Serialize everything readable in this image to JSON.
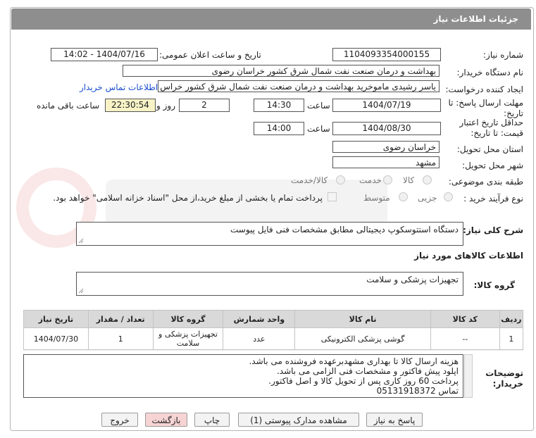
{
  "header": {
    "title": "جزئیات اطلاعات نیاز"
  },
  "fields": {
    "need_number_label": "شماره نیاز:",
    "need_number": "1104093354000155",
    "announce_label": "تاریخ و ساعت اعلان عمومی:",
    "announce_value": "1404/07/16 - 14:02",
    "buyer_label": "نام دستگاه خریدار:",
    "buyer_value": "بهداشت و درمان صنعت نفت شمال شرق کشور   خراسان رضوی",
    "requester_label": "ایجاد کننده درخواست:",
    "requester_value": "یاسر رشیدی ماموخرید بهداشت و درمان صنعت نفت شمال شرق کشور   خراس",
    "contact_link": "اطلاعات تماس خریدار",
    "deadline_label_1": "مهلت ارسال پاسخ: تا",
    "deadline_label_2": "تاریخ:",
    "deadline_date": "1404/07/19",
    "time_label": "ساعت",
    "deadline_time": "14:30",
    "days_value": "2",
    "days_label": "روز و",
    "remaining_value": "22:30:54",
    "remaining_label": "ساعت باقی مانده",
    "validity_label_1": "حداقل تاریخ اعتبار",
    "validity_label_2": "قیمت: تا تاریخ:",
    "validity_date": "1404/08/30",
    "validity_time": "14:00",
    "province_label": "استان محل تحویل:",
    "province_value": "خراسان رضوی",
    "city_label": "شهر محل تحویل:",
    "city_value": "مشهد",
    "category_label": "طبقه بندی موضوعی:",
    "category_options": [
      "کالا",
      "خدمت",
      "کالا/خدمت"
    ],
    "purchase_label": "نوع فرآیند خرید :",
    "purchase_options": [
      "جزیی",
      "متوسط"
    ],
    "payment_note": "پرداخت تمام یا بخشی از مبلغ خرید،از محل \"اسناد خزانه اسلامی\" خواهد بود."
  },
  "description": {
    "label": "شرح کلی نیاز:",
    "value": "دستگاه استتوسکوپ دیجیتالی مطابق مشخصات فنی فایل پیوست"
  },
  "goods_info_label": "اطلاعات کالاهای مورد نیاز",
  "goods_group": {
    "label": "گروه کالا:",
    "value": "تجهیزات پزشکی و سلامت"
  },
  "table": {
    "headers": [
      "ردیف",
      "کد کالا",
      "نام کالا",
      "واحد شمارش",
      "گروه کالا",
      "تعداد / مقدار",
      "تاریخ نیاز"
    ],
    "rows": [
      [
        "1",
        "--",
        "گوشی پزشکی الکترونیکی",
        "عدد",
        "تجهیزات پزشکی و سلامت",
        "1",
        "1404/07/30"
      ]
    ]
  },
  "buyer_notes": {
    "label_1": "توضیحات",
    "label_2": "خریدار:",
    "lines": [
      "هزینه ارسال کالا تا بهداری مشهدبرعهده فروشنده می باشد.",
      "اپلود پیش فاکتور و مشخصات فنی الزامی می باشد.",
      "پرداخت 60 روز کاری پس از تحویل کالا و اصل فاکتور.",
      "تماس 05131918372"
    ]
  },
  "buttons": {
    "respond": "پاسخ به نیاز",
    "attachments": "مشاهده مدارک پیوستی (1)",
    "print": "چاپ",
    "back": "بازگشت",
    "exit": "خروج"
  },
  "colors": {
    "header_bg": "#8e8e8e",
    "link": "#1a4fd1",
    "remaining_bg": "#f7f3c6",
    "back_btn": "#f7d4d4"
  }
}
